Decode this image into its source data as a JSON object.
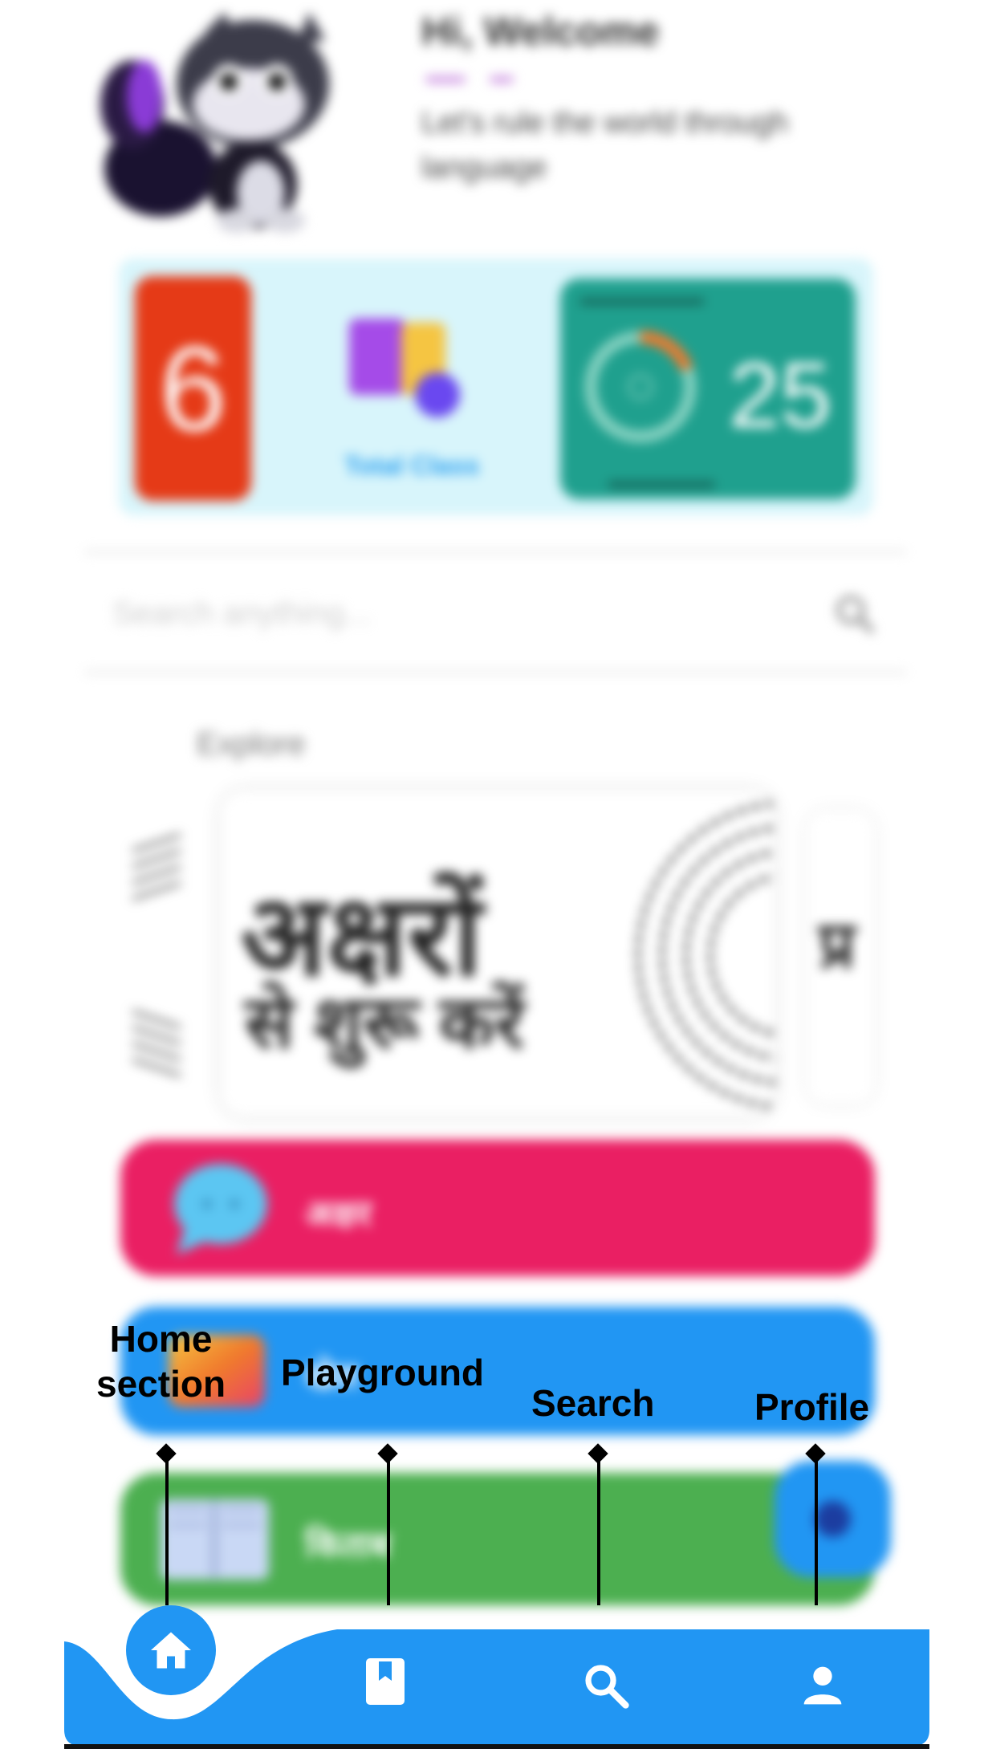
{
  "header": {
    "title": "Hi, Welcome",
    "subtitle": "Let's rule the world through language"
  },
  "stats": {
    "streak_value": "6",
    "total_class_label": "Total Class",
    "progress_value": "25",
    "colors": {
      "streak": "#e53a17",
      "progress": "#1fa08e",
      "panel": "#d8f5fb"
    }
  },
  "search": {
    "placeholder": "Search anything..."
  },
  "explore": {
    "title": "Explore",
    "featured_card": {
      "line1": "अक्षरों",
      "line2": "से शुरू करें"
    },
    "side_card_fragment": "प्र"
  },
  "menu": [
    {
      "label": "अक्षर",
      "color": "#ea1f63",
      "icon": "chat-bubble-icon"
    },
    {
      "label": "खेल",
      "color": "#2196f3",
      "icon": "gradient-tile-icon"
    },
    {
      "label": "किताब",
      "color": "#4caf50",
      "icon": "book-icon"
    }
  ],
  "bottom_nav": {
    "items": [
      {
        "name": "home",
        "icon": "home-icon",
        "active": true
      },
      {
        "name": "playground",
        "icon": "book-bookmark-icon"
      },
      {
        "name": "search",
        "icon": "search-icon"
      },
      {
        "name": "profile",
        "icon": "person-icon"
      }
    ],
    "color": "#2196f3"
  },
  "annotations": {
    "home": "Home section",
    "home_line1": "Home",
    "home_line2": "section",
    "playground": "Playground",
    "search": "Search",
    "profile": "Profile"
  }
}
